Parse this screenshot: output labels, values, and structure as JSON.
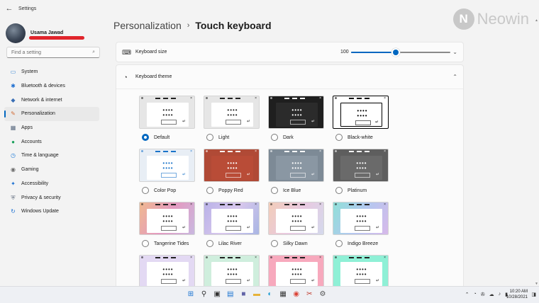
{
  "window": {
    "title": "Settings",
    "back_icon": "←"
  },
  "user": {
    "name": "Usama Jawad"
  },
  "search": {
    "placeholder": "Find a setting",
    "icon": "⌕"
  },
  "nav": [
    {
      "label": "System",
      "icon": "▭",
      "color": "#2d7fd3"
    },
    {
      "label": "Bluetooth & devices",
      "icon": "✱",
      "color": "#1f6fd1"
    },
    {
      "label": "Network & internet",
      "icon": "◆",
      "color": "#3a6fb5"
    },
    {
      "label": "Personalization",
      "icon": "✎",
      "color": "#d26a33",
      "active": true
    },
    {
      "label": "Apps",
      "icon": "▦",
      "color": "#5a6a80"
    },
    {
      "label": "Accounts",
      "icon": "●",
      "color": "#18a05a"
    },
    {
      "label": "Time & language",
      "icon": "◷",
      "color": "#1f7bd8"
    },
    {
      "label": "Gaming",
      "icon": "◉",
      "color": "#6b6b6b"
    },
    {
      "label": "Accessibility",
      "icon": "✦",
      "color": "#1a6fd1"
    },
    {
      "label": "Privacy & security",
      "icon": "⛨",
      "color": "#6b7686"
    },
    {
      "label": "Windows Update",
      "icon": "↻",
      "color": "#1a6fd1"
    }
  ],
  "breadcrumb": {
    "parent": "Personalization",
    "separator": "›",
    "current": "Touch keyboard"
  },
  "watermark": {
    "mark": "N",
    "text": "Neowin"
  },
  "keyboard_size": {
    "label": "Keyboard size",
    "value": "100",
    "level": 0.45,
    "chevron": "⌄"
  },
  "keyboard_theme": {
    "label": "Keyboard theme",
    "chevron": "⌃"
  },
  "themes": [
    {
      "name": "Default",
      "selected": true,
      "bg": "#e6e6e6",
      "body": "#ffffff",
      "fg": "#222222"
    },
    {
      "name": "Light",
      "selected": false,
      "bg": "#e6e6e6",
      "body": "#ffffff",
      "fg": "#222222"
    },
    {
      "name": "Dark",
      "selected": false,
      "bg": "#1f1f1f",
      "body": "#2b2b2b",
      "fg": "#ffffff"
    },
    {
      "name": "Black-white",
      "selected": false,
      "bg": "#ffffff",
      "body": "#ffffff",
      "fg": "#000000"
    },
    {
      "name": "Color Pop",
      "selected": false,
      "bg": "#e8eef5",
      "body": "#ffffff",
      "fg": "#1a73c9"
    },
    {
      "name": "Poppy Red",
      "selected": false,
      "bg": "#b04a36",
      "body": "#b94c37",
      "fg": "#ffffff"
    },
    {
      "name": "Ice Blue",
      "selected": false,
      "bg": "#7d8a96",
      "body": "#8a97a3",
      "fg": "#ffffff"
    },
    {
      "name": "Platinum",
      "selected": false,
      "bg": "#5e5e5e",
      "body": "#6a6a6a",
      "fg": "#ffffff"
    },
    {
      "name": "Tangerine Tides",
      "selected": false,
      "bg": "linear-gradient(120deg,#f0b98f,#e39ac0,#c9b8e0)",
      "body": "#ffffff",
      "fg": "#222222"
    },
    {
      "name": "Lilac River",
      "selected": false,
      "bg": "linear-gradient(120deg,#b9b2e8,#d8c7ec,#a9b6e4)",
      "body": "#ffffff",
      "fg": "#222222"
    },
    {
      "name": "Silky Dawn",
      "selected": false,
      "bg": "linear-gradient(120deg,#f2cdb8,#e8c9e0,#d4d9ec)",
      "body": "#ffffff",
      "fg": "#222222"
    },
    {
      "name": "Indigo Breeze",
      "selected": false,
      "bg": "linear-gradient(120deg,#8fe0d8,#b4c7ef,#d7b9ea)",
      "body": "#ffffff",
      "fg": "#222222"
    },
    {
      "name": "",
      "selected": false,
      "bg": "#e3d9f3",
      "body": "#ffffff",
      "fg": "#222222"
    },
    {
      "name": "",
      "selected": false,
      "bg": "#cfeedd",
      "body": "#ffffff",
      "fg": "#222222"
    },
    {
      "name": "",
      "selected": false,
      "bg": "#f7a9bd",
      "body": "#ffffff",
      "fg": "#222222"
    },
    {
      "name": "",
      "selected": false,
      "bg": "#8ff0d6",
      "body": "#ffffff",
      "fg": "#222222"
    }
  ],
  "taskbar": {
    "apps": [
      {
        "name": "start",
        "glyph": "⊞",
        "color": "#1a73d1"
      },
      {
        "name": "search",
        "glyph": "⚲",
        "color": "#333333"
      },
      {
        "name": "task-view",
        "glyph": "▣",
        "color": "#333333"
      },
      {
        "name": "widgets",
        "glyph": "▤",
        "color": "#1a73d1"
      },
      {
        "name": "chat",
        "glyph": "■",
        "color": "#6264a7"
      },
      {
        "name": "file-explorer",
        "glyph": "▬",
        "color": "#e6b23a"
      },
      {
        "name": "edge",
        "glyph": "◐",
        "color": "#1a9ad1"
      },
      {
        "name": "store",
        "glyph": "▦",
        "color": "#333333"
      },
      {
        "name": "chrome",
        "glyph": "◉",
        "color": "#db4437"
      },
      {
        "name": "snip",
        "glyph": "✂",
        "color": "#c0392b"
      },
      {
        "name": "settings",
        "glyph": "⚙",
        "color": "#555555"
      }
    ],
    "tray_icons": [
      "⌃",
      "◔",
      "✇",
      "☁",
      "♪",
      "▮"
    ],
    "time": "10:20 AM",
    "date": "10/28/2021",
    "notifications_icon": "◨"
  }
}
